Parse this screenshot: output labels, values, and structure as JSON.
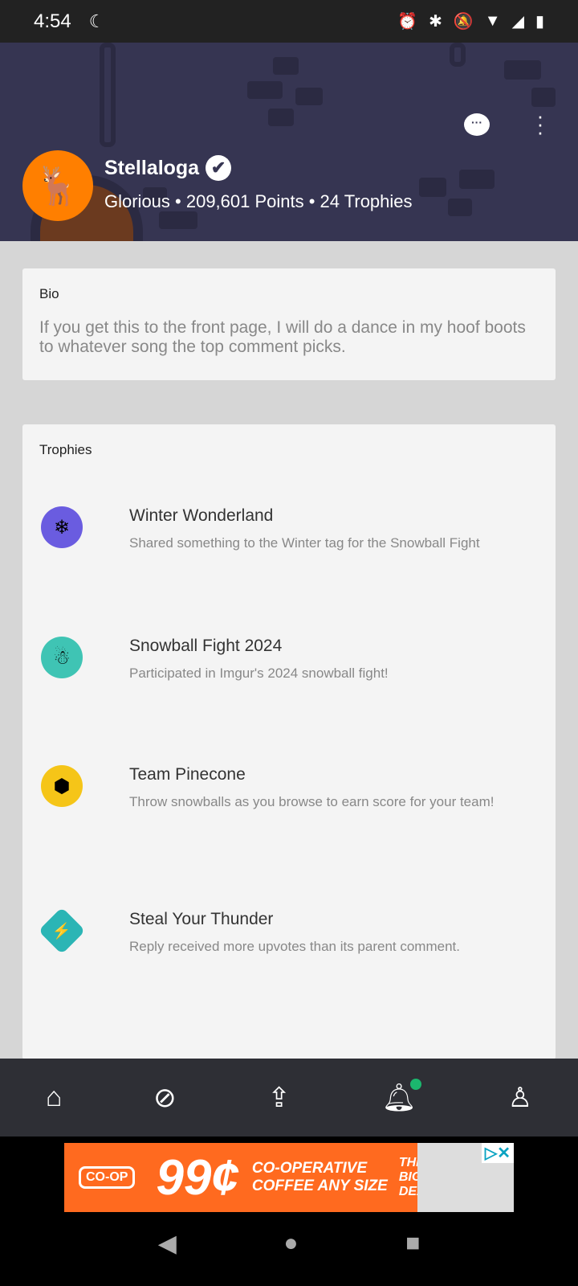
{
  "status_bar": {
    "time": "4:54"
  },
  "profile": {
    "username": "Stellaloga",
    "stats": "Glorious • 209,601 Points • 24 Trophies"
  },
  "bio": {
    "title": "Bio",
    "text": "If you get this to the front page, I will do a dance in my hoof boots to whatever song the top comment picks."
  },
  "trophies": {
    "title": "Trophies",
    "items": [
      {
        "name": "Winter Wonderland",
        "desc": "Shared something to the Winter tag for the Snowball Fight",
        "color": "#6a5ce0"
      },
      {
        "name": "Snowball Fight 2024",
        "desc": "Participated in Imgur's 2024 snowball fight!",
        "color": "#3fc4b4"
      },
      {
        "name": "Team Pinecone",
        "desc": "Throw snowballs as you browse to earn score for your team!",
        "color": "#f5c518"
      },
      {
        "name": "Steal Your Thunder",
        "desc": "Reply received more upvotes than its parent comment.",
        "color": "#2bb5b5"
      }
    ]
  },
  "ad": {
    "brand": "CO-OP",
    "price": "99¢",
    "line1": "CO-OPERATIVE",
    "line2": "COFFEE ANY SIZE",
    "badge": "THE BIG DEAL"
  }
}
